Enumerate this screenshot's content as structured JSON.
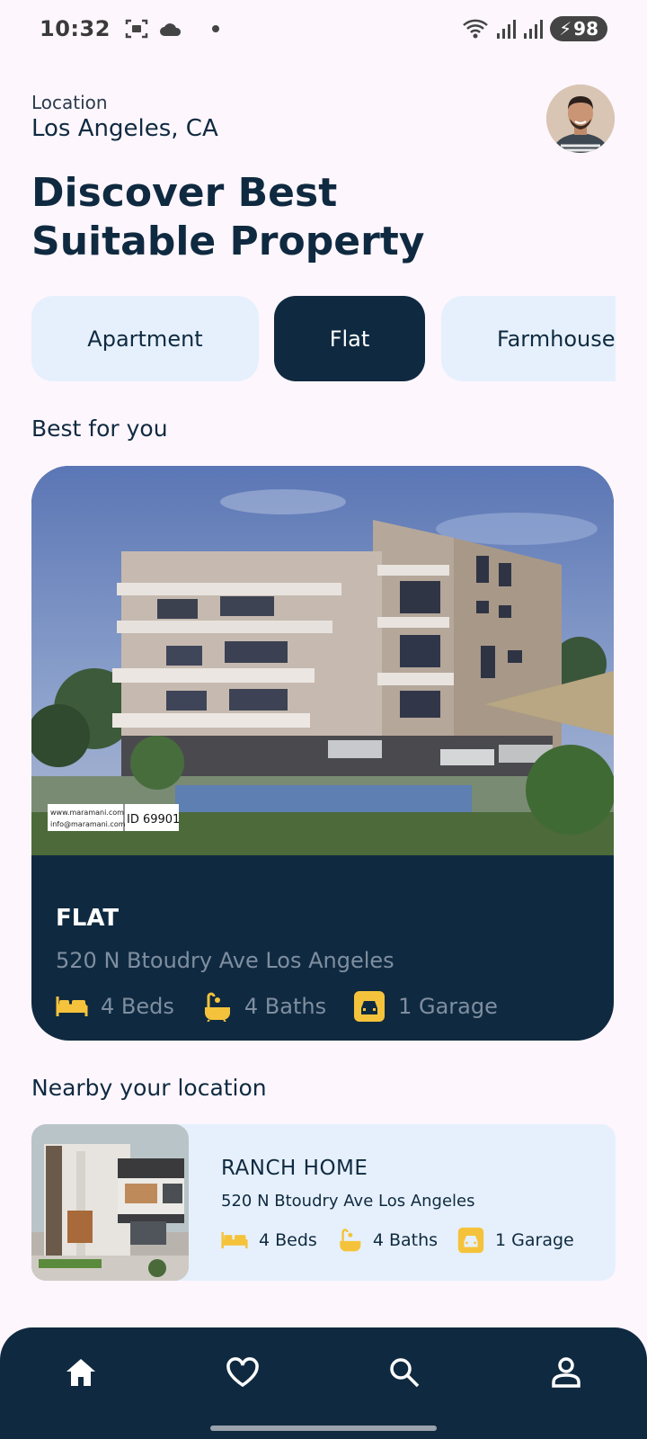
{
  "status_bar": {
    "time": "10:32",
    "battery": "98"
  },
  "header": {
    "location_label": "Location",
    "location_value": "Los Angeles, CA",
    "title_line1": "Discover Best",
    "title_line2": "Suitable Property"
  },
  "categories": [
    {
      "label": "Apartment",
      "active": false
    },
    {
      "label": "Flat",
      "active": true
    },
    {
      "label": "Farmhouse",
      "active": false
    }
  ],
  "best_for_you": {
    "section_title": "Best for you",
    "watermark_line1": "www.maramani.com",
    "watermark_line2": "info@maramani.com",
    "watermark_id": "ID 69901",
    "type": "FLAT",
    "address": "520 N Btoudry Ave Los Angeles",
    "beds": "4 Beds",
    "baths": "4 Baths",
    "garage": "1 Garage"
  },
  "nearby": {
    "section_title": "Nearby your location",
    "type": "RANCH HOME",
    "address": "520 N Btoudry Ave Los Angeles",
    "beds": "4 Beds",
    "baths": "4 Baths",
    "garage": "1 Garage"
  },
  "nav": {
    "items": [
      "home-icon",
      "heart-icon",
      "search-icon",
      "profile-icon"
    ]
  },
  "colors": {
    "primary": "#0f2a40",
    "background": "#fdf6fd",
    "card_light": "#e6f0fc",
    "amenity_icon": "#f5c33b",
    "muted_text": "#7f8ea0"
  }
}
